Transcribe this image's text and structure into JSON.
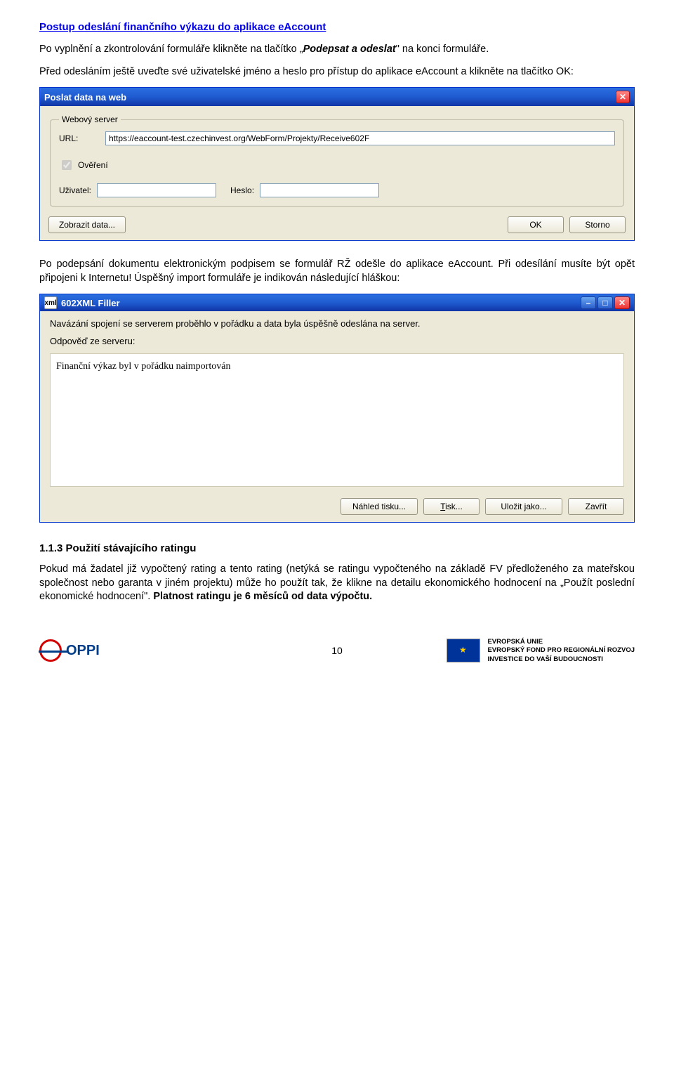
{
  "heading": "Postup odeslání finančního výkazu do aplikace eAccount",
  "para1_a": "Po vyplnění a zkontrolování formuláře klikněte na tlačítko „",
  "para1_b": "Podepsat a odeslat",
  "para1_c": "\" na konci formuláře.",
  "para2": "Před odesláním ještě uveďte své uživatelské jméno a heslo pro přístup do aplikace eAccount a klikněte na tlačítko OK:",
  "dialog1": {
    "title": "Poslat data na web",
    "group": "Webový server",
    "url_label": "URL:",
    "url_value": "https://eaccount-test.czechinvest.org/WebForm/Projekty/Receive602F",
    "verify": "Ověření",
    "user_label": "Uživatel:",
    "user_value": "",
    "pass_label": "Heslo:",
    "pass_value": "",
    "btn_show": "Zobrazit data...",
    "btn_ok": "OK",
    "btn_cancel": "Storno",
    "close": "✕"
  },
  "para3": "Po podepsání dokumentu elektronickým podpisem se formulář RŽ odešle do aplikace eAccount. Při odesílání musíte být opět připojeni k Internetu! Úspěšný import formuláře je indikován následující hláškou:",
  "window": {
    "title": "602XML Filler",
    "icon": "xml",
    "msg": "Navázání spojení se serverem proběhlo v pořádku a data byla úspěšně odeslána na server.",
    "resp_label": "Odpověď ze serveru:",
    "resp_text": "Finanční výkaz byl v pořádku naimportován",
    "btn_preview": "Náhled tisku...",
    "btn_print_pre": "T",
    "btn_print_post": "isk...",
    "btn_save": "Uložit jako...",
    "btn_close": "Zavřít",
    "min": "–",
    "max": "□",
    "x": "✕"
  },
  "section": "1.1.3  Použití stávajícího ratingu",
  "para4": "Pokud má žadatel již vypočtený rating a tento rating (netýká se ratingu vypočteného na základě FV předloženého za mateřskou společnost nebo garanta v jiném projektu) může ho použít tak, že klikne na detailu ekonomického hodnocení na „Použít poslední ekonomické hodnocení\". ",
  "para4_bold": "Platnost ratingu je 6 měsíců od data výpočtu.",
  "footer": {
    "oppi": "OPPI",
    "page": "10",
    "eu1": "EVROPSKÁ UNIE",
    "eu2": "EVROPSKÝ FOND PRO REGIONÁLNÍ ROZVOJ",
    "eu3": "INVESTICE DO VAŠÍ BUDOUCNOSTI"
  }
}
